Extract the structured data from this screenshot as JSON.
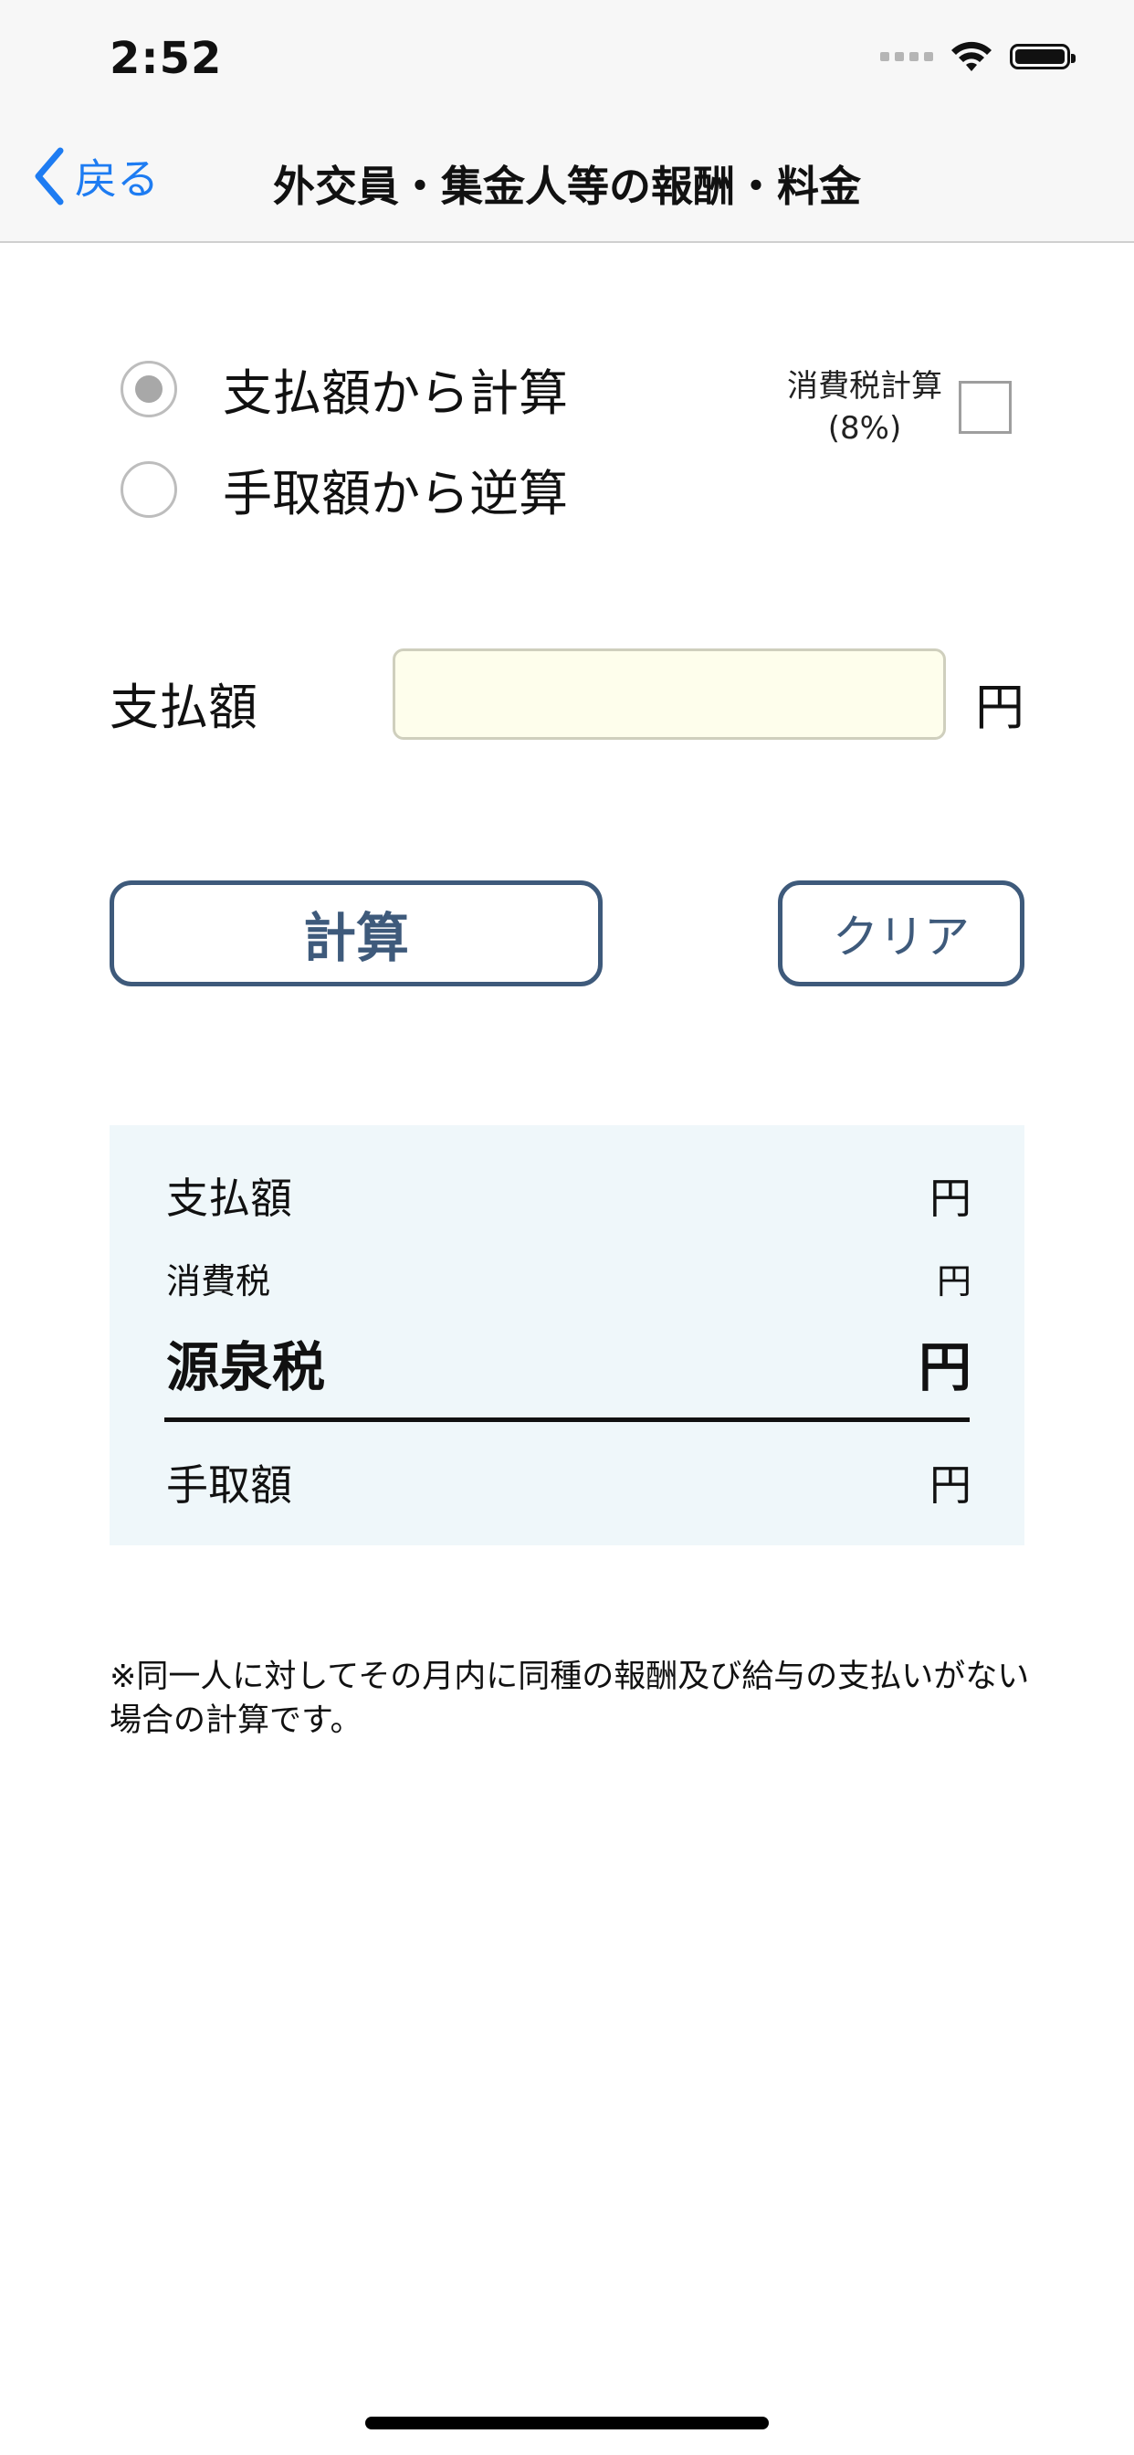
{
  "status_bar": {
    "time": "2:52"
  },
  "nav": {
    "back_label": "戻る",
    "title": "外交員・集金人等の報酬・料金"
  },
  "mode": {
    "options": [
      {
        "label": "支払額から計算",
        "selected": true
      },
      {
        "label": "手取額から逆算",
        "selected": false
      }
    ]
  },
  "tax_option": {
    "label_line1": "消費税計算",
    "label_line2": "(8%)",
    "checked": false
  },
  "input": {
    "label": "支払額",
    "value": "",
    "unit": "円"
  },
  "buttons": {
    "calc": "計算",
    "clear": "クリア"
  },
  "result": {
    "payment_label": "支払額",
    "payment_unit": "円",
    "consumption_tax_label": "消費税",
    "consumption_tax_unit": "円",
    "withholding_label": "源泉税",
    "withholding_unit": "円",
    "net_label": "手取額",
    "net_unit": "円"
  },
  "note": "※同一人に対してその月内に同種の報酬及び給与の支払いがない場合の計算です。"
}
